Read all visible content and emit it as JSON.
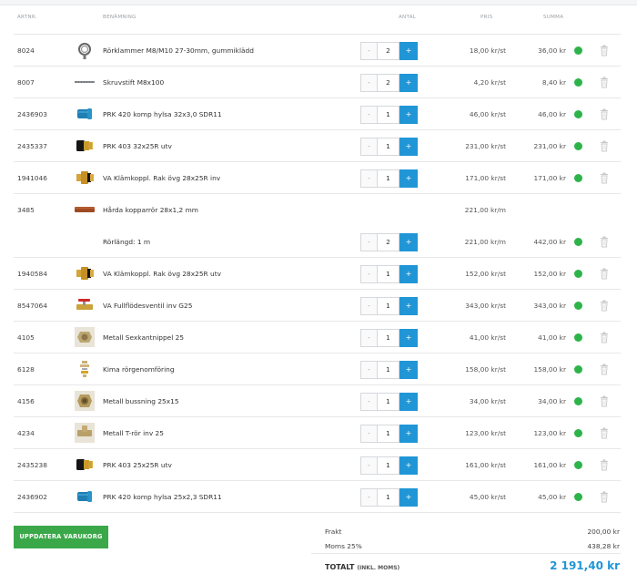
{
  "headers": {
    "artnr": "ARTNR.",
    "name": "BENÄMNING",
    "qty": "ANTAL",
    "price": "PRIS",
    "sum": "SUMMA"
  },
  "rows": [
    {
      "artnr": "8024",
      "name": "Rörklammer M8/M10 27-30mm, gummiklädd",
      "qty": "2",
      "price": "18,00 kr/st",
      "sum": "36,00 kr",
      "icon": "pipe-clamp-icon"
    },
    {
      "artnr": "8007",
      "name": "Skruvstift M8x100",
      "qty": "2",
      "price": "4,20 kr/st",
      "sum": "8,40 kr",
      "icon": "threaded-rod-icon"
    },
    {
      "artnr": "2436903",
      "name": "PRK 420 komp hylsa 32x3,0 SDR11",
      "qty": "1",
      "price": "46,00 kr/st",
      "sum": "46,00 kr",
      "icon": "sleeve-icon"
    },
    {
      "artnr": "2435337",
      "name": "PRK 403 32x25R utv",
      "qty": "1",
      "price": "231,00 kr/st",
      "sum": "231,00 kr",
      "icon": "fitting-icon"
    },
    {
      "artnr": "1941046",
      "name": "VA Klämkoppl. Rak övg 28x25R inv",
      "qty": "1",
      "price": "171,00 kr/st",
      "sum": "171,00 kr",
      "icon": "coupling-icon"
    },
    {
      "artnr": "3485",
      "name": "Hårda kopparrör 28x1,2 mm",
      "price": "221,00 kr/m",
      "icon": "copper-pipe-icon"
    },
    {
      "name": "Rörlängd: 1 m",
      "qty": "2",
      "price": "221,00 kr/m",
      "sum": "442,00 kr"
    },
    {
      "artnr": "1940584",
      "name": "VA Klämkoppl. Rak övg 28x25R utv",
      "qty": "1",
      "price": "152,00 kr/st",
      "sum": "152,00 kr",
      "icon": "coupling-icon"
    },
    {
      "artnr": "8547064",
      "name": "VA Fullflödesventil inv G25",
      "qty": "1",
      "price": "343,00 kr/st",
      "sum": "343,00 kr",
      "icon": "valve-icon"
    },
    {
      "artnr": "4105",
      "name": "Metall Sexkantnippel 25",
      "qty": "1",
      "price": "41,00 kr/st",
      "sum": "41,00 kr",
      "icon": "hex-nipple-icon"
    },
    {
      "artnr": "6128",
      "name": "Kima rörgenomföring",
      "qty": "1",
      "price": "158,00 kr/st",
      "sum": "158,00 kr",
      "icon": "pipe-passthrough-icon"
    },
    {
      "artnr": "4156",
      "name": "Metall bussning 25x15",
      "qty": "1",
      "price": "34,00 kr/st",
      "sum": "34,00 kr",
      "icon": "bushing-icon"
    },
    {
      "artnr": "4234",
      "name": "Metall T-rör inv 25",
      "qty": "1",
      "price": "123,00 kr/st",
      "sum": "123,00 kr",
      "icon": "tee-icon"
    },
    {
      "artnr": "2435238",
      "name": "PRK 403 25x25R utv",
      "qty": "1",
      "price": "161,00 kr/st",
      "sum": "161,00 kr",
      "icon": "fitting-icon"
    },
    {
      "artnr": "2436902",
      "name": "PRK 420 komp hylsa 25x2,3 SDR11",
      "qty": "1",
      "price": "45,00 kr/st",
      "sum": "45,00 kr",
      "icon": "sleeve-icon"
    }
  ],
  "stepper": {
    "minus": "-",
    "plus": "+"
  },
  "update_button": "UPPDATERA VARUKORG",
  "totals": {
    "shipping_label": "Frakt",
    "shipping_value": "200,00 kr",
    "vat_label": "Moms 25%",
    "vat_value": "438,28 kr",
    "total_label": "TOTALT",
    "total_note": "(INKL. MOMS)",
    "total_value": "2 191,40 kr"
  },
  "colors": {
    "accent": "#2196d6",
    "stock_ok": "#2db34a",
    "update_button": "#3aa849"
  }
}
